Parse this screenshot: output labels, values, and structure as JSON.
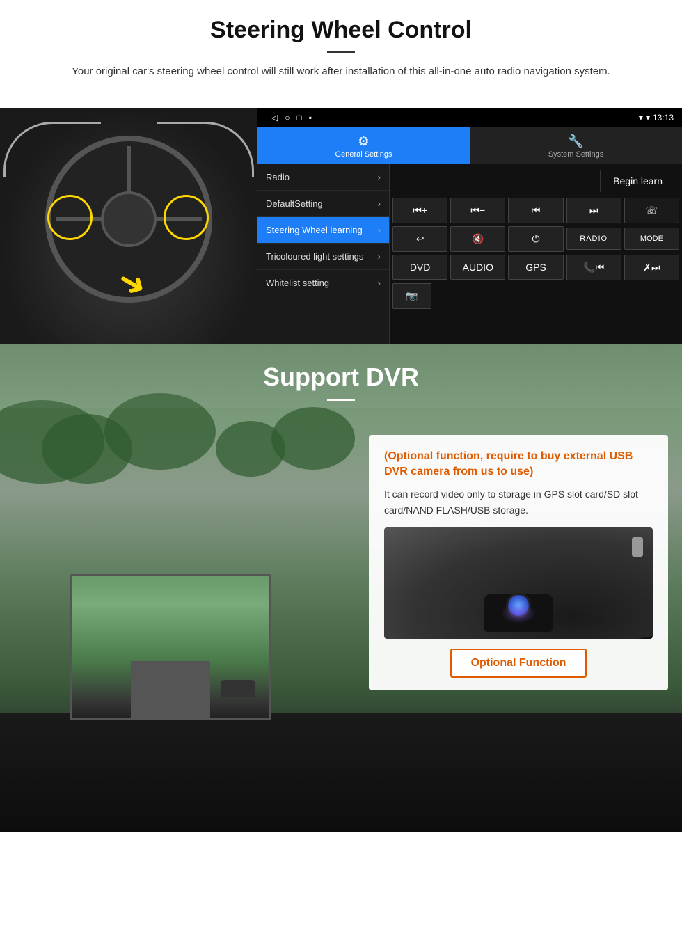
{
  "steering": {
    "title": "Steering Wheel Control",
    "subtitle": "Your original car's steering wheel control will still work after installation of this all-in-one auto radio navigation system.",
    "statusbar": {
      "time": "13:13",
      "nav_icons": [
        "◁",
        "○",
        "□",
        "▪"
      ]
    },
    "tabs": [
      {
        "label": "General Settings",
        "active": true
      },
      {
        "label": "System Settings",
        "active": false
      }
    ],
    "menu_items": [
      {
        "label": "Radio",
        "active": false
      },
      {
        "label": "DefaultSetting",
        "active": false
      },
      {
        "label": "Steering Wheel learning",
        "active": true
      },
      {
        "label": "Tricoloured light settings",
        "active": false
      },
      {
        "label": "Whitelist setting",
        "active": false
      }
    ],
    "begin_learn": "Begin learn",
    "control_buttons_row1": [
      "⏮+",
      "⏮-",
      "⏮",
      "⏭",
      "☎"
    ],
    "control_buttons_row2": [
      "↩",
      "🔇",
      "⏻",
      "RADIO",
      "MODE"
    ],
    "control_buttons_row3": [
      "DVD",
      "AUDIO",
      "GPS",
      "📞⏮",
      "✗⏭"
    ],
    "control_buttons_row4": [
      "📷"
    ]
  },
  "dvr": {
    "title": "Support DVR",
    "info_title": "(Optional function, require to buy external USB DVR camera from us to use)",
    "info_text": "It can record video only to storage in GPS slot card/SD slot card/NAND FLASH/USB storage.",
    "optional_button": "Optional Function"
  }
}
